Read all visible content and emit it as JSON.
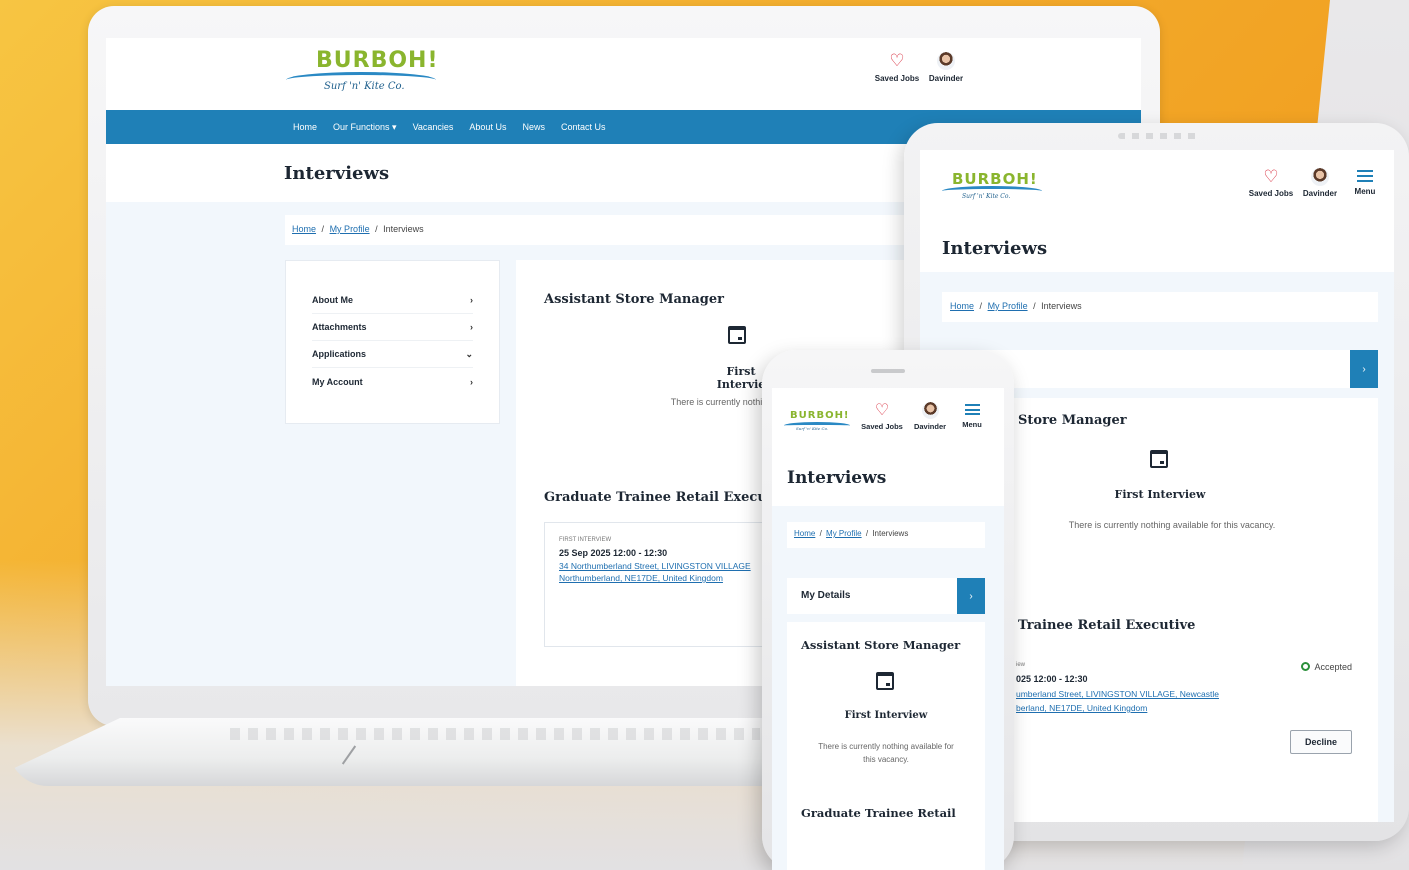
{
  "brand": {
    "name": "BURBOH!",
    "tagline": "Surf 'n' Kite Co."
  },
  "header": {
    "saved_label": "Saved Jobs",
    "user_name": "Davinder",
    "menu_label": "Menu"
  },
  "nav": {
    "items": [
      "Home",
      "Our Functions ▾",
      "Vacancies",
      "About Us",
      "News",
      "Contact Us"
    ]
  },
  "page": {
    "title": "Interviews"
  },
  "breadcrumb": {
    "home": "Home",
    "sep": "/",
    "profile": "My Profile",
    "current": "Interviews"
  },
  "sidebar": {
    "items": [
      {
        "label": "About Me",
        "chev": "›"
      },
      {
        "label": "Attachments",
        "chev": "›"
      },
      {
        "label": "Applications",
        "chev": "⌄"
      },
      {
        "label": "My Account",
        "chev": "›"
      }
    ]
  },
  "my_details": {
    "label": "My Details",
    "tablet_partial": "ls",
    "chev": "›"
  },
  "jobs": {
    "first": {
      "title": "Assistant Store Manager",
      "tablet_partial": "Store Manager",
      "stage": "First Interview",
      "laptop_stage": "First Intervie",
      "empty": "There is currently nothing available for this vacancy.",
      "laptop_empty": "There is currently nothing avail",
      "phone_empty_1": "There is currently nothing available for",
      "phone_empty_2": "this vacancy."
    },
    "second": {
      "title": "Graduate Trainee Retail Executive",
      "tablet_partial": "Trainee Retail Executive",
      "phone_partial": "Graduate Trainee Retail",
      "interview_type": "FIRST INTERVIEW",
      "tablet_type": "iew",
      "date": "25 Sep 2025 12:00 - 12:30",
      "tablet_date": "025 12:00 - 12:30",
      "addr1": "34 Northumberland Street, LIVINGSTON VILLAGE",
      "addr2": "Northumberland, NE17DE, United Kingdom",
      "tablet_addr1": "umberland Street, LIVINGSTON VILLAGE, Newcastle",
      "tablet_addr2": "berland, NE17DE, United Kingdom",
      "status": "Accepted",
      "decline": "Decline"
    }
  },
  "colors": {
    "brand_blue": "#1f80b7",
    "brand_green": "#8ab52e",
    "heart_red": "#d83040",
    "accepted_green": "#2b8f3a"
  }
}
